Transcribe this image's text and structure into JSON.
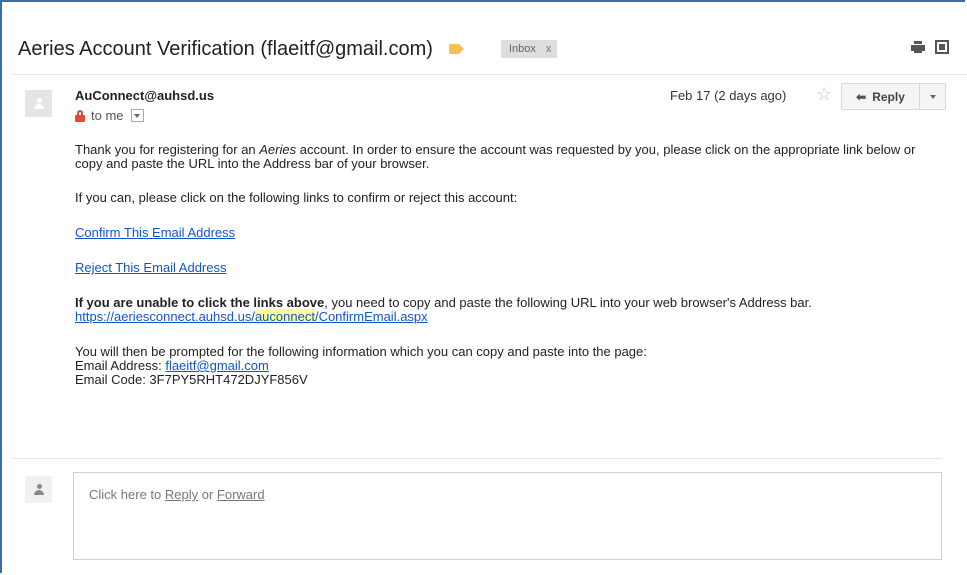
{
  "email": {
    "subject": "Aeries Account Verification (flaeitf@gmail.com)",
    "label_chip": "Inbox",
    "label_chip_close": "x",
    "sender": "AuConnect@auhsd.us",
    "recipient": "to me",
    "date": "Feb 17 (2 days ago)",
    "reply_label": "Reply"
  },
  "body": {
    "p1_before": "Thank you for registering for an ",
    "p1_em": "Aeries",
    "p1_after": " account. In order to ensure the account was requested by you, please click on the appropriate link below or copy and paste the URL into the Address bar of your browser.",
    "p2": "If you can, please click on the following links to confirm or reject this account:",
    "confirm_link": "Confirm This Email Address",
    "reject_link": "Reject This Email Address",
    "p5_bold": "If you are unable to click the links above",
    "p5_rest": ", you need to copy and paste the following URL into your web browser's Address bar.",
    "url_part1": "https://aeriesconnect.auhsd.us/",
    "url_highlight": "auconnect",
    "url_part2": "/ConfirmEmail.aspx",
    "p6": "You will then be prompted for the following information which you can copy and paste into the page:",
    "email_address_label": "Email Address: ",
    "email_address_value": "flaeitf@gmail.com",
    "email_code_label": "Email Code: ",
    "email_code_value": "3F7PY5RHT472DJYF856V"
  },
  "reply_box": {
    "prefix": "Click here to ",
    "reply": "Reply",
    "or": " or ",
    "forward": "Forward"
  },
  "colors": {
    "frame": "#3b6db3",
    "link": "#1155cc",
    "label_tag": "#f2c14e",
    "lock": "#dd4b39",
    "highlight": "#ffff99"
  }
}
